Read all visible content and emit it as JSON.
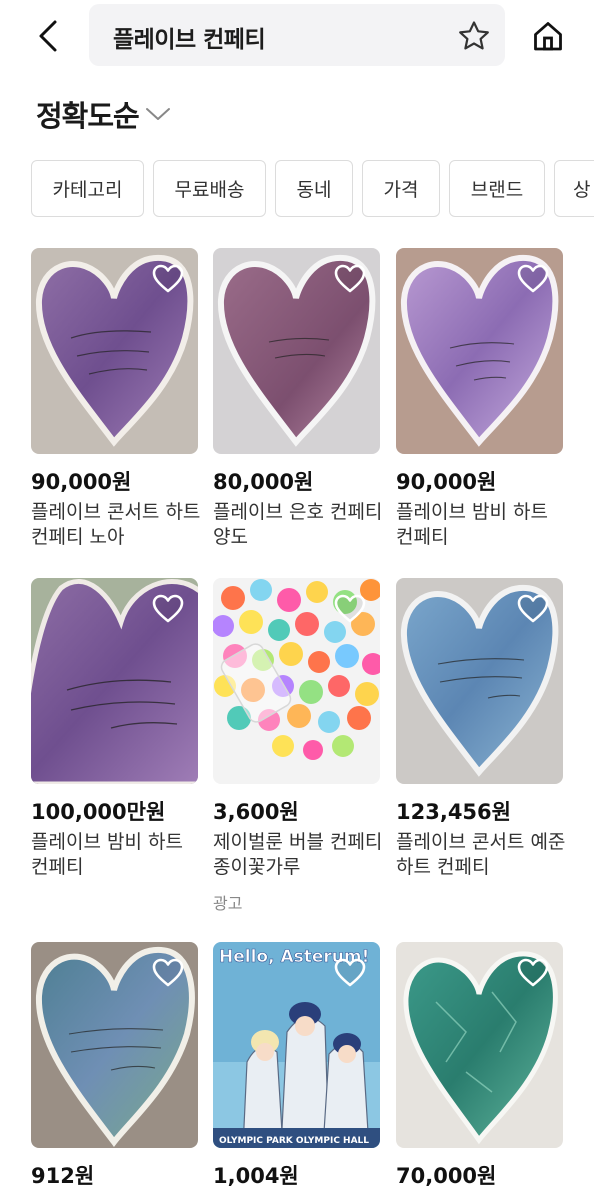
{
  "header": {
    "search_query": "플레이브 컨페티",
    "back_icon": "chevron-left-icon",
    "favorite_icon": "star-outline-icon",
    "home_icon": "home-icon"
  },
  "sort": {
    "label": "정확도순",
    "icon": "chevron-down-icon"
  },
  "filters": [
    "카테고리",
    "무료배송",
    "동네",
    "가격",
    "브랜드",
    "상"
  ],
  "products": [
    {
      "price": "90,000원",
      "title": "플레이브 콘서트 하트 컨페티 노아",
      "ad": ""
    },
    {
      "price": "80,000원",
      "title": "플레이브 은호 컨페티 양도",
      "ad": ""
    },
    {
      "price": "90,000원",
      "title": "플레이브 밤비 하트 컨페티",
      "ad": ""
    },
    {
      "price": "100,000만원",
      "title": "플레이브 밤비 하트 컨페티",
      "ad": ""
    },
    {
      "price": "3,600원",
      "title": "제이벌룬 버블 컨페티 종이꽃가루",
      "ad": "광고"
    },
    {
      "price": "123,456원",
      "title": "플레이브 콘서트 예준 하트 컨페티",
      "ad": ""
    },
    {
      "price": "912원",
      "title": "",
      "ad": ""
    },
    {
      "price": "1,004원",
      "title": "",
      "ad": ""
    },
    {
      "price": "70,000원",
      "title": "",
      "ad": ""
    }
  ],
  "poster": {
    "headline": "Hello, Asterum!",
    "footer": "OLYMPIC PARK OLYMPIC HALL"
  },
  "colors": {
    "accent": "#1a1a1a",
    "chip_border": "#dcdcdc",
    "search_bg": "#f3f3f5",
    "muted_text": "#888888"
  }
}
